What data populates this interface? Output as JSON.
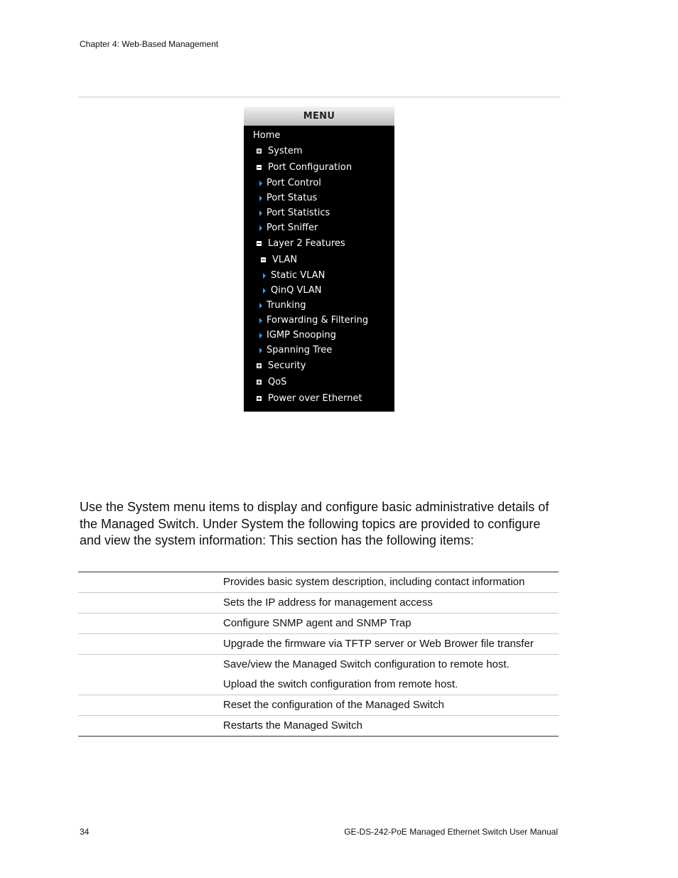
{
  "header": {
    "chapter": "Chapter 4: Web-Based Management"
  },
  "menu": {
    "title": "MENU",
    "items": [
      {
        "label": "Home",
        "type": "link",
        "level": 0
      },
      {
        "label": "System",
        "type": "collapsed",
        "level": 1
      },
      {
        "label": "Port Configuration",
        "type": "expanded",
        "level": 1
      },
      {
        "label": "Port Control",
        "type": "leaf",
        "level": 2
      },
      {
        "label": "Port Status",
        "type": "leaf",
        "level": 2
      },
      {
        "label": "Port Statistics",
        "type": "leaf",
        "level": 2
      },
      {
        "label": "Port Sniffer",
        "type": "leaf",
        "level": 2
      },
      {
        "label": "Layer 2 Features",
        "type": "expanded",
        "level": 1
      },
      {
        "label": "VLAN",
        "type": "expanded",
        "level": 2
      },
      {
        "label": "Static VLAN",
        "type": "leaf",
        "level": 3
      },
      {
        "label": "QinQ VLAN",
        "type": "leaf",
        "level": 3
      },
      {
        "label": "Trunking",
        "type": "leaf",
        "level": 2
      },
      {
        "label": "Forwarding & Filtering",
        "type": "leaf",
        "level": 2
      },
      {
        "label": "IGMP Snooping",
        "type": "leaf",
        "level": 2
      },
      {
        "label": "Spanning Tree",
        "type": "leaf",
        "level": 2
      },
      {
        "label": "Security",
        "type": "collapsed",
        "level": 1
      },
      {
        "label": "QoS",
        "type": "collapsed",
        "level": 1
      },
      {
        "label": "Power over Ethernet",
        "type": "collapsed",
        "level": 1
      }
    ],
    "icons": {
      "collapsed": "plus-box-icon",
      "expanded": "minus-box-icon",
      "leaf": "triangle-right-icon"
    },
    "colors": {
      "background": "#000000",
      "text": "#ffffff",
      "arrow": "#3d9be9"
    }
  },
  "body": {
    "paragraph": "Use the System menu items to display and configure basic administrative details of the Managed Switch. Under System the following topics are provided to configure and view the system information: This section has the following items:"
  },
  "table": {
    "rows": [
      {
        "name": "",
        "description": [
          "Provides basic system description, including contact information"
        ]
      },
      {
        "name": "",
        "description": [
          "Sets the IP address for management access"
        ]
      },
      {
        "name": "",
        "description": [
          "Configure SNMP agent and SNMP Trap"
        ]
      },
      {
        "name": "",
        "description": [
          "Upgrade the firmware via TFTP server or Web Brower file transfer"
        ]
      },
      {
        "name": "",
        "description": [
          "Save/view the Managed Switch configuration to remote host.",
          "Upload the switch configuration from remote host."
        ]
      },
      {
        "name": "",
        "description": [
          "Reset the configuration of the Managed Switch"
        ]
      },
      {
        "name": "",
        "description": [
          "Restarts the Managed Switch"
        ]
      }
    ]
  },
  "footer": {
    "page_number": "34",
    "manual_title": "GE-DS-242-PoE Managed Ethernet Switch User Manual"
  }
}
